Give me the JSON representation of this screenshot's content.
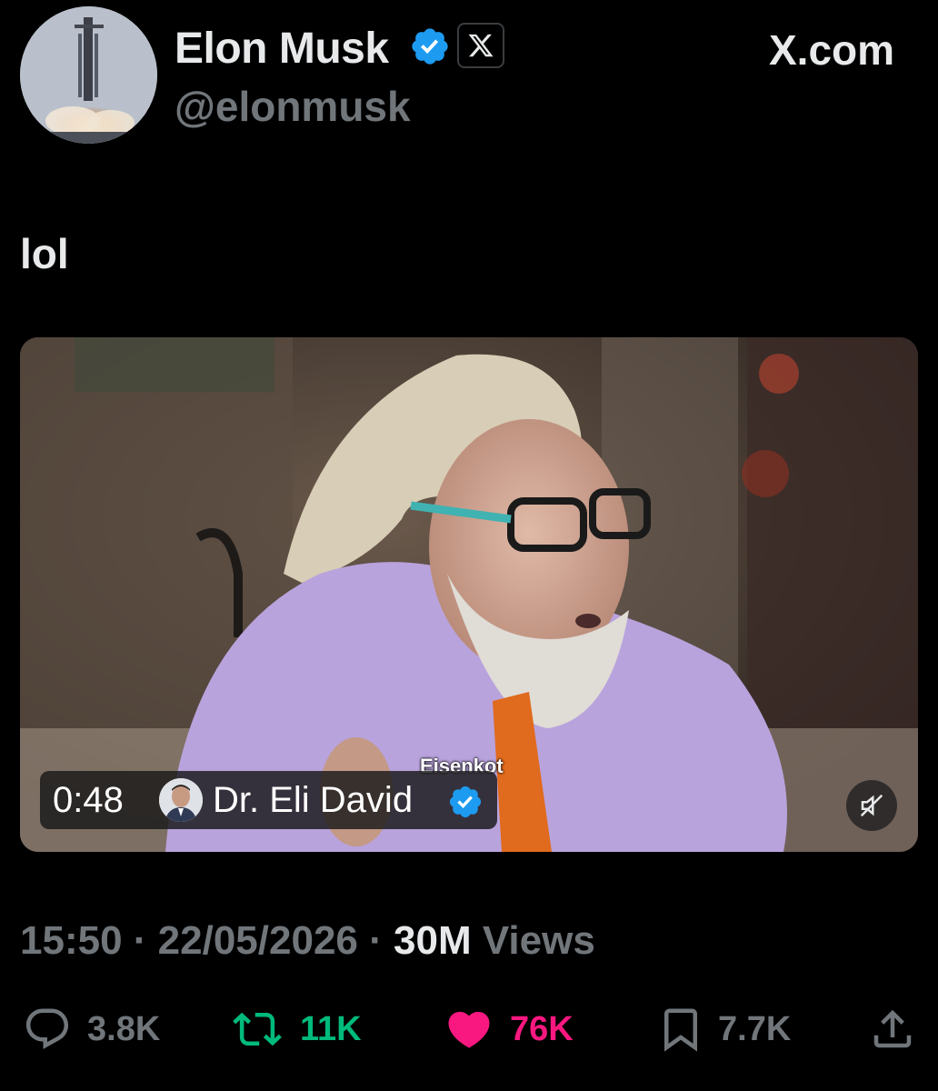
{
  "author": {
    "name": "Elon Musk",
    "handle": "@elonmusk",
    "verified": true
  },
  "brand": {
    "site_label": "X.com",
    "affiliate_glyph": "𝕏"
  },
  "tweet": {
    "text": "lol"
  },
  "video": {
    "duration": "0:48",
    "creator_name": "Dr. Eli David",
    "creator_verified": true,
    "subtitle_text": "Eisenkot",
    "muted": true
  },
  "meta": {
    "time": "15:50",
    "separator": "·",
    "date": "22/05/2026",
    "views_count": "30M",
    "views_label": "Views"
  },
  "actions": {
    "replies": "3.8K",
    "reposts": "11K",
    "likes": "76K",
    "bookmarks": "7.7K"
  },
  "colors": {
    "background": "#000000",
    "text_primary": "#e7e9ea",
    "text_secondary": "#71767b",
    "verified_blue": "#1d9bf0",
    "repost_green": "#00ba7c",
    "like_pink": "#f91880"
  }
}
